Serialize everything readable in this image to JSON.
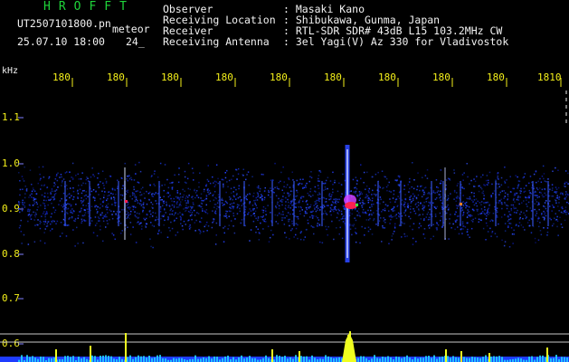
{
  "header": {
    "brand": "HROFFT",
    "filename": "UT2507101800.pn",
    "meteor_label": "meteor",
    "datetime": "25.07.10 18:00",
    "count": "24_"
  },
  "info": [
    {
      "label": "Observer",
      "value": ": Masaki Kano"
    },
    {
      "label": "Receiving Location",
      "value": ": Shibukawa, Gunma, Japan"
    },
    {
      "label": "Receiver",
      "value": ": RTL-SDR SDR# 43dB L15 103.2MHz CW"
    },
    {
      "label": "Receiving Antenna",
      "value": ": 3el Yagi(V) Az 330 for Vladivostok"
    }
  ],
  "axis": {
    "unit": "kHz",
    "x_ticks": [
      "180",
      "180",
      "180",
      "180",
      "180",
      "180",
      "180",
      "180",
      "180",
      "1810"
    ],
    "y_ticks": [
      "1.1",
      "1.0",
      "0.9",
      "0.8",
      "0.7",
      "0.6"
    ]
  },
  "colors": {
    "text_green": "#1fd53a",
    "text_white": "#f2f2f2",
    "text_yellow": "#f4f01a",
    "noise_blue": "#1a2fd0",
    "echo_red": "#ff2050",
    "echo_magenta": "#d040ff"
  }
}
